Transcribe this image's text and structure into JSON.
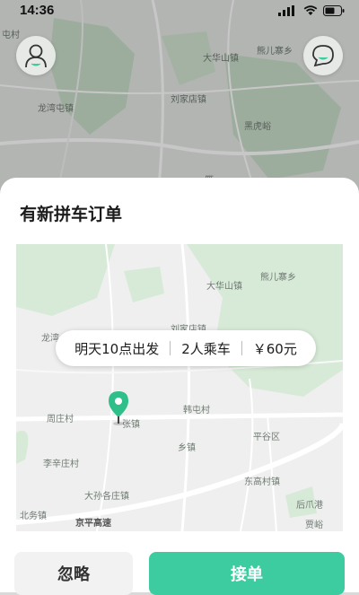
{
  "status_bar": {
    "time": "14:36"
  },
  "background_map": {
    "labels": [
      "屯村",
      "大华山镇",
      "熊儿寨乡",
      "龙湾屯镇",
      "刘家店镇",
      "黑虎峪",
      "雁"
    ]
  },
  "sheet": {
    "title": "有新拼车订单",
    "order_info": {
      "departure": "明天10点出发",
      "passengers": "2人乘车",
      "price": "￥60元"
    },
    "map_labels": [
      "大华山镇",
      "熊儿寨乡",
      "龙湾",
      "刘家店镇",
      "周庄村",
      "张镇",
      "韩屯村",
      "乡镇",
      "平谷区",
      "李辛庄村",
      "东高村镇",
      "大孙各庄镇",
      "后爪港",
      "北务镇",
      "京平高速",
      "贾峪"
    ]
  },
  "actions": {
    "ignore_label": "忽略",
    "accept_label": "接单"
  },
  "colors": {
    "accent": "#3ccca0",
    "pin": "#2fbf8a",
    "map_green": "#cfe6cf",
    "map_road": "#ffffff"
  }
}
